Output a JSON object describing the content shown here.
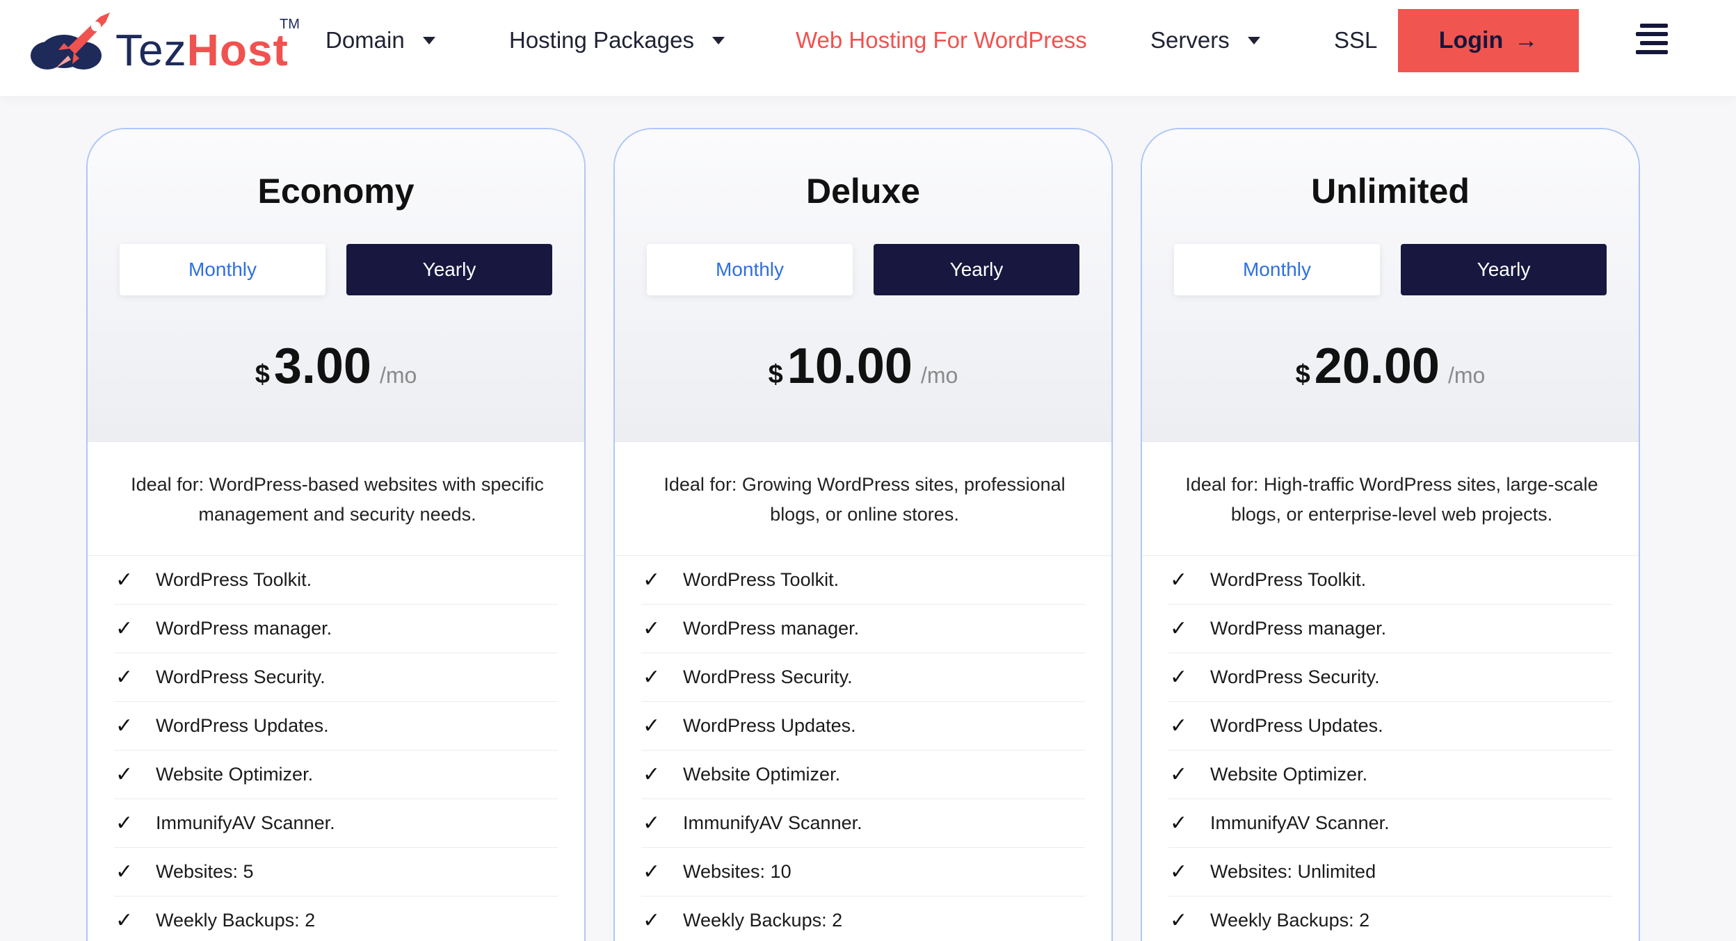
{
  "brand": {
    "name_part1": "Tez",
    "name_part2": "Host",
    "trademark": "TM"
  },
  "nav": {
    "items": [
      {
        "label": "Domain",
        "has_dropdown": true
      },
      {
        "label": "Hosting Packages",
        "has_dropdown": true
      },
      {
        "label": "Web Hosting For WordPress",
        "has_dropdown": false,
        "active": true
      },
      {
        "label": "Servers",
        "has_dropdown": true
      },
      {
        "label": "SSL",
        "has_dropdown": false
      }
    ],
    "login_label": "Login",
    "login_arrow": "→"
  },
  "colors": {
    "accent": "#f0524f",
    "navy": "#17173f",
    "link_blue": "#2f6fe0",
    "card_border": "#aec7f7"
  },
  "plans": [
    {
      "name": "Economy",
      "toggle_monthly": "Monthly",
      "toggle_yearly": "Yearly",
      "currency": "$",
      "price": "3.00",
      "period": "/mo",
      "ideal_for": "Ideal for: WordPress-based websites with specific management and security needs.",
      "features": [
        "WordPress Toolkit.",
        "WordPress manager.",
        "WordPress Security.",
        "WordPress Updates.",
        "Website Optimizer.",
        "ImmunifyAV Scanner.",
        "Websites: 5",
        "Weekly Backups: 2"
      ]
    },
    {
      "name": "Deluxe",
      "toggle_monthly": "Monthly",
      "toggle_yearly": "Yearly",
      "currency": "$",
      "price": "10.00",
      "period": "/mo",
      "ideal_for": "Ideal for: Growing WordPress sites, professional blogs, or online stores.",
      "features": [
        "WordPress Toolkit.",
        "WordPress manager.",
        "WordPress Security.",
        "WordPress Updates.",
        "Website Optimizer.",
        "ImmunifyAV Scanner.",
        "Websites: 10",
        "Weekly Backups: 2"
      ]
    },
    {
      "name": "Unlimited",
      "toggle_monthly": "Monthly",
      "toggle_yearly": "Yearly",
      "currency": "$",
      "price": "20.00",
      "period": "/mo",
      "ideal_for": "Ideal for: High-traffic WordPress sites, large-scale blogs, or enterprise-level web projects.",
      "features": [
        "WordPress Toolkit.",
        "WordPress manager.",
        "WordPress Security.",
        "WordPress Updates.",
        "Website Optimizer.",
        "ImmunifyAV Scanner.",
        "Websites: Unlimited",
        "Weekly Backups: 2"
      ]
    }
  ],
  "icons": {
    "check": "✓",
    "menu": "hamburger-menu-icon",
    "logo": "rocket-cloud-icon"
  }
}
